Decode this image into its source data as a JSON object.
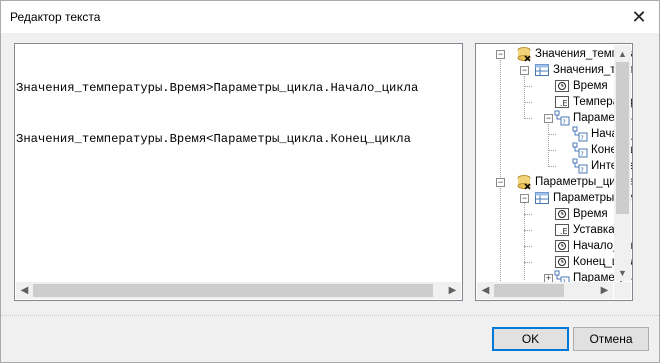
{
  "window": {
    "title": "Редактор текста",
    "close_label": "✕"
  },
  "editor": {
    "lines": [
      "Значения_температуры.Время>Параметры_цикла.Начало_цикла",
      "Значения_температуры.Время<Параметры_цикла.Конец_цикла"
    ]
  },
  "tree": {
    "nodes": [
      {
        "label": "Значения_температуры",
        "icon": "database-icon"
      },
      {
        "label": "Значения_температуры",
        "icon": "table-icon"
      },
      {
        "label": "Время",
        "icon": "clock-icon"
      },
      {
        "label": "Температура",
        "icon": "field-icon"
      },
      {
        "label": "Параметры_цикла",
        "icon": "reference-icon"
      },
      {
        "label": "Начало_цикла",
        "icon": "reference-icon"
      },
      {
        "label": "Конец_цикла",
        "icon": "reference-icon"
      },
      {
        "label": "Интервал",
        "icon": "reference-icon"
      },
      {
        "label": "Параметры_цикла",
        "icon": "database-icon"
      },
      {
        "label": "Параметры_цикла",
        "icon": "table-icon"
      },
      {
        "label": "Время",
        "icon": "clock-icon"
      },
      {
        "label": "Уставка",
        "icon": "field-icon"
      },
      {
        "label": "Начало_цикла",
        "icon": "clock-icon"
      },
      {
        "label": "Конец_цикла",
        "icon": "clock-icon"
      },
      {
        "label": "Параметры",
        "icon": "reference-icon"
      }
    ]
  },
  "buttons": {
    "ok": "OK",
    "cancel": "Отмена"
  }
}
